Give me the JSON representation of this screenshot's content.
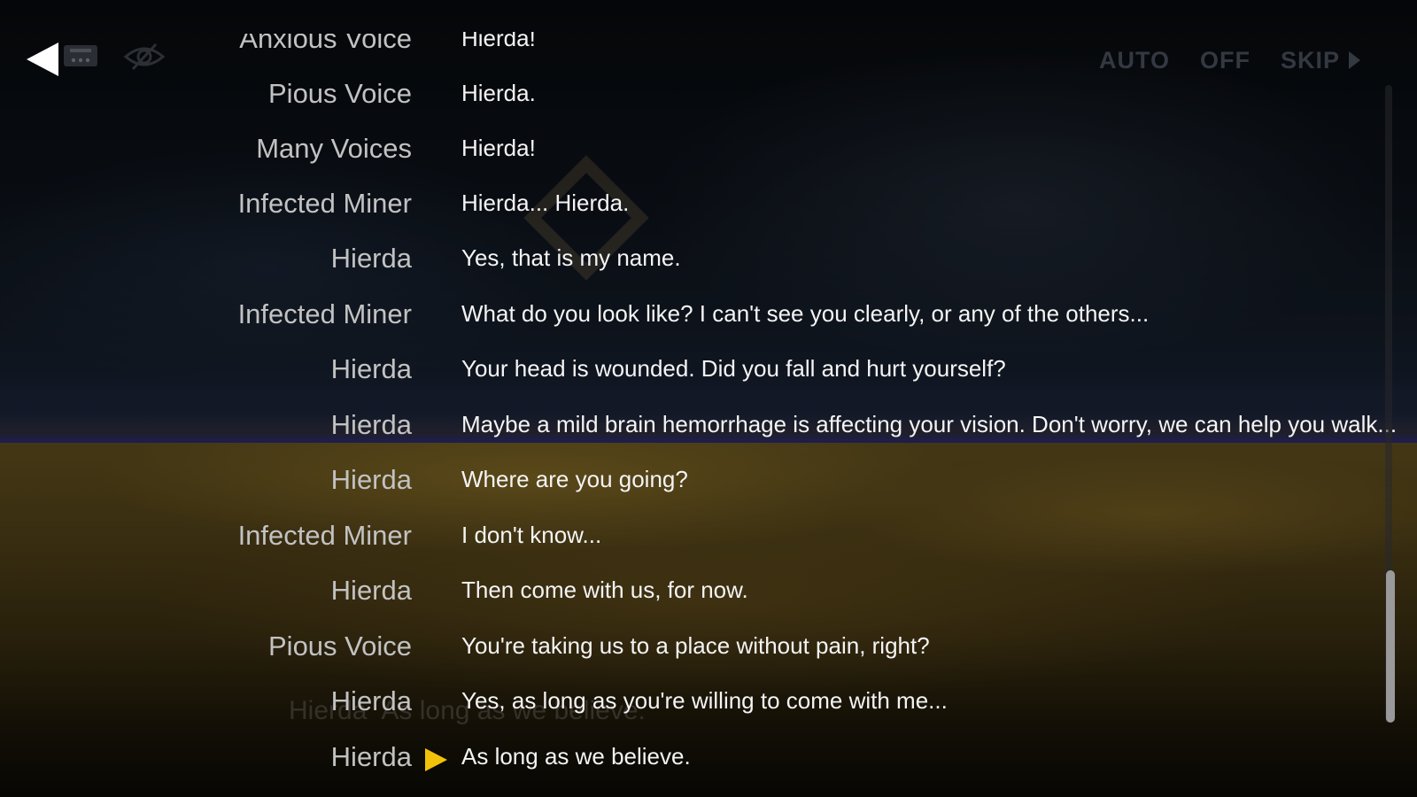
{
  "controls": {
    "auto_label": "AUTO",
    "auto_state": "OFF",
    "skip_label": "SKIP"
  },
  "icons": {
    "back": "back-arrow-icon",
    "log": "dialogue-log-icon",
    "hide_ui": "eye-slash-icon",
    "skip": "play-arrow-icon",
    "current": "current-line-marker-icon"
  },
  "colors": {
    "speaker_text": "#c2c2c2",
    "line_text": "#f4f4f4",
    "current_marker": "#f2c20a",
    "inactive_control": "#343841"
  },
  "dialogue": [
    {
      "speaker": "Anxious Voice",
      "line": "Hierda!"
    },
    {
      "speaker": "Pious Voice",
      "line": "Hierda."
    },
    {
      "speaker": "Many Voices",
      "line": "Hierda!"
    },
    {
      "speaker": "Infected Miner",
      "line": "Hierda... Hierda."
    },
    {
      "speaker": "Hierda",
      "line": "Yes, that is my name."
    },
    {
      "speaker": "Infected Miner",
      "line": "What do you look like? I can't see you clearly, or any of the others..."
    },
    {
      "speaker": "Hierda",
      "line": "Your head is wounded. Did you fall and hurt yourself?"
    },
    {
      "speaker": "Hierda",
      "line": "Maybe a mild brain hemorrhage is affecting your vision. Don't worry, we can help you walk..."
    },
    {
      "speaker": "Hierda",
      "line": "Where are you going?"
    },
    {
      "speaker": "Infected Miner",
      "line": "I don't know..."
    },
    {
      "speaker": "Hierda",
      "line": "Then come with us, for now."
    },
    {
      "speaker": "Pious Voice",
      "line": "You're taking us to a place without pain, right?"
    },
    {
      "speaker": "Hierda",
      "line": "Yes, as long as you're willing to come with me..."
    },
    {
      "speaker": "Hierda",
      "line": "As long as we believe.",
      "current": true
    }
  ],
  "ghost": {
    "speaker": "Hierda",
    "line": "As long as we believe."
  }
}
